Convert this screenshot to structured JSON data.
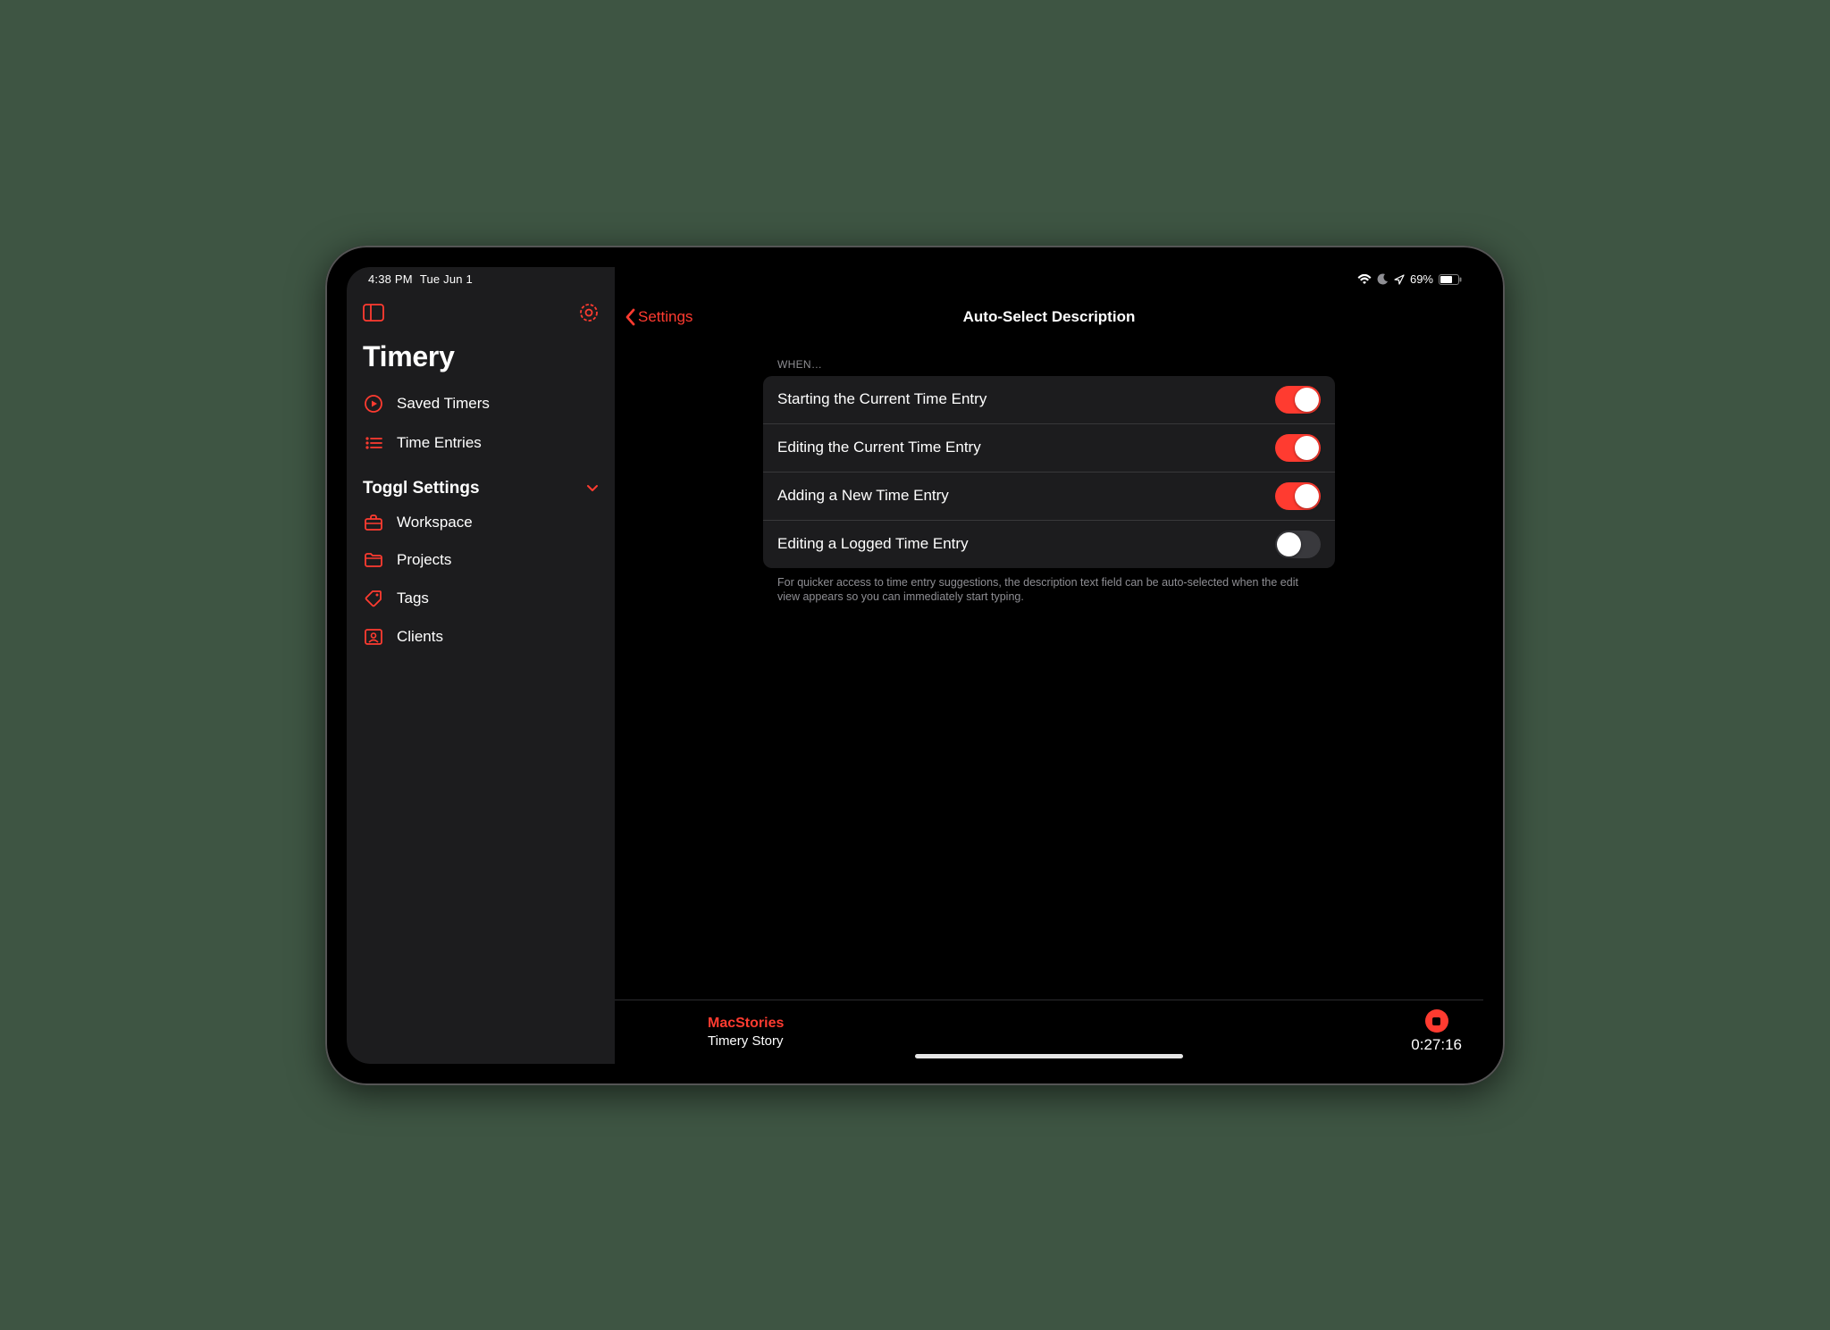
{
  "status": {
    "time": "4:38 PM",
    "date": "Tue Jun 1",
    "battery_pct": "69%"
  },
  "sidebar": {
    "app_title": "Timery",
    "items": [
      {
        "label": "Saved Timers"
      },
      {
        "label": "Time Entries"
      }
    ],
    "section_title": "Toggl Settings",
    "settings_items": [
      {
        "label": "Workspace"
      },
      {
        "label": "Projects"
      },
      {
        "label": "Tags"
      },
      {
        "label": "Clients"
      }
    ]
  },
  "main": {
    "back_label": "Settings",
    "title": "Auto-Select Description",
    "group_header": "WHEN…",
    "rows": [
      {
        "label": "Starting the Current Time Entry",
        "on": true
      },
      {
        "label": "Editing the Current Time Entry",
        "on": true
      },
      {
        "label": "Adding a New Time Entry",
        "on": true
      },
      {
        "label": "Editing a Logged Time Entry",
        "on": false
      }
    ],
    "footer": "For quicker access to time entry suggestions, the description text field can be auto-selected when the edit view appears so you can immediately start typing."
  },
  "now_playing": {
    "project": "MacStories",
    "description": "Timery Story",
    "elapsed": "0:27:16"
  }
}
